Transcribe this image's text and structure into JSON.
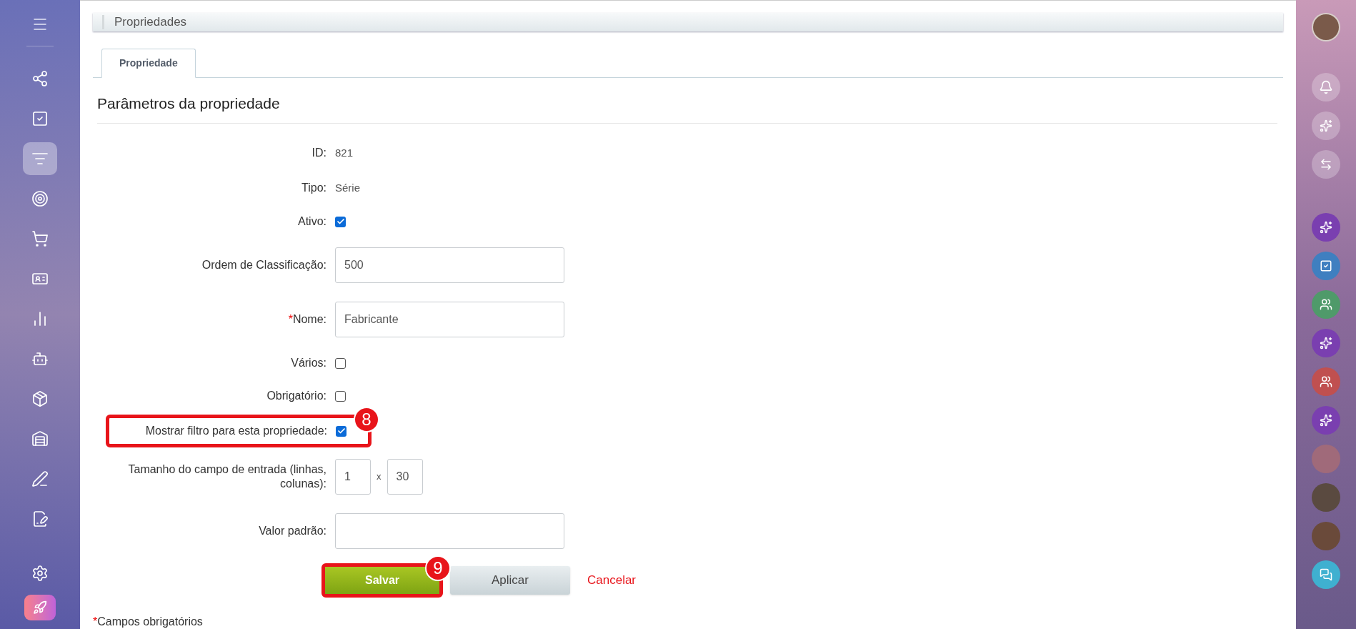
{
  "left_nav": {
    "items": [
      {
        "selected": false
      },
      {
        "selected": false
      },
      {
        "selected": true
      },
      {
        "selected": false
      },
      {
        "selected": false
      },
      {
        "selected": false
      },
      {
        "selected": false
      },
      {
        "selected": false
      },
      {
        "selected": false
      },
      {
        "selected": false
      },
      {
        "selected": false
      },
      {
        "selected": false
      }
    ]
  },
  "header": {
    "title": "Propriedades"
  },
  "tabs": [
    {
      "label": "Propriedade",
      "selected": true
    }
  ],
  "section_title": "Parâmetros da propriedade",
  "fields": [
    {
      "kind": "text",
      "label": "ID:",
      "value": "821"
    },
    {
      "kind": "text",
      "label": "Tipo:",
      "value": "Série"
    },
    {
      "kind": "checkbox",
      "label": "Ativo:",
      "checked": true
    },
    {
      "kind": "input",
      "label": "Ordem de Classificação:",
      "value": "500"
    },
    {
      "kind": "input",
      "label": "Nome:",
      "required_mark": "*",
      "value": "Fabricante"
    },
    {
      "kind": "checkbox",
      "label": "Vários:",
      "checked": false
    },
    {
      "kind": "checkbox",
      "label": "Obrigatório:",
      "checked": false
    },
    {
      "kind": "checkbox",
      "label": "Mostrar filtro para esta propriedade:",
      "checked": true,
      "callout": "8"
    },
    {
      "kind": "size",
      "label": "Tamanho do campo de entrada (linhas, colunas):",
      "rows": "1",
      "separator": "x",
      "cols": "30"
    },
    {
      "kind": "input",
      "label": "Valor padrão:"
    }
  ],
  "buttons": [
    {
      "kind": "primary",
      "label": "Salvar",
      "callout": "9"
    },
    {
      "kind": "secondary",
      "label": "Aplicar"
    },
    {
      "kind": "link",
      "label": "Cancelar"
    }
  ],
  "footnote": {
    "mark": "*",
    "text": "Campos obrigatórios"
  }
}
